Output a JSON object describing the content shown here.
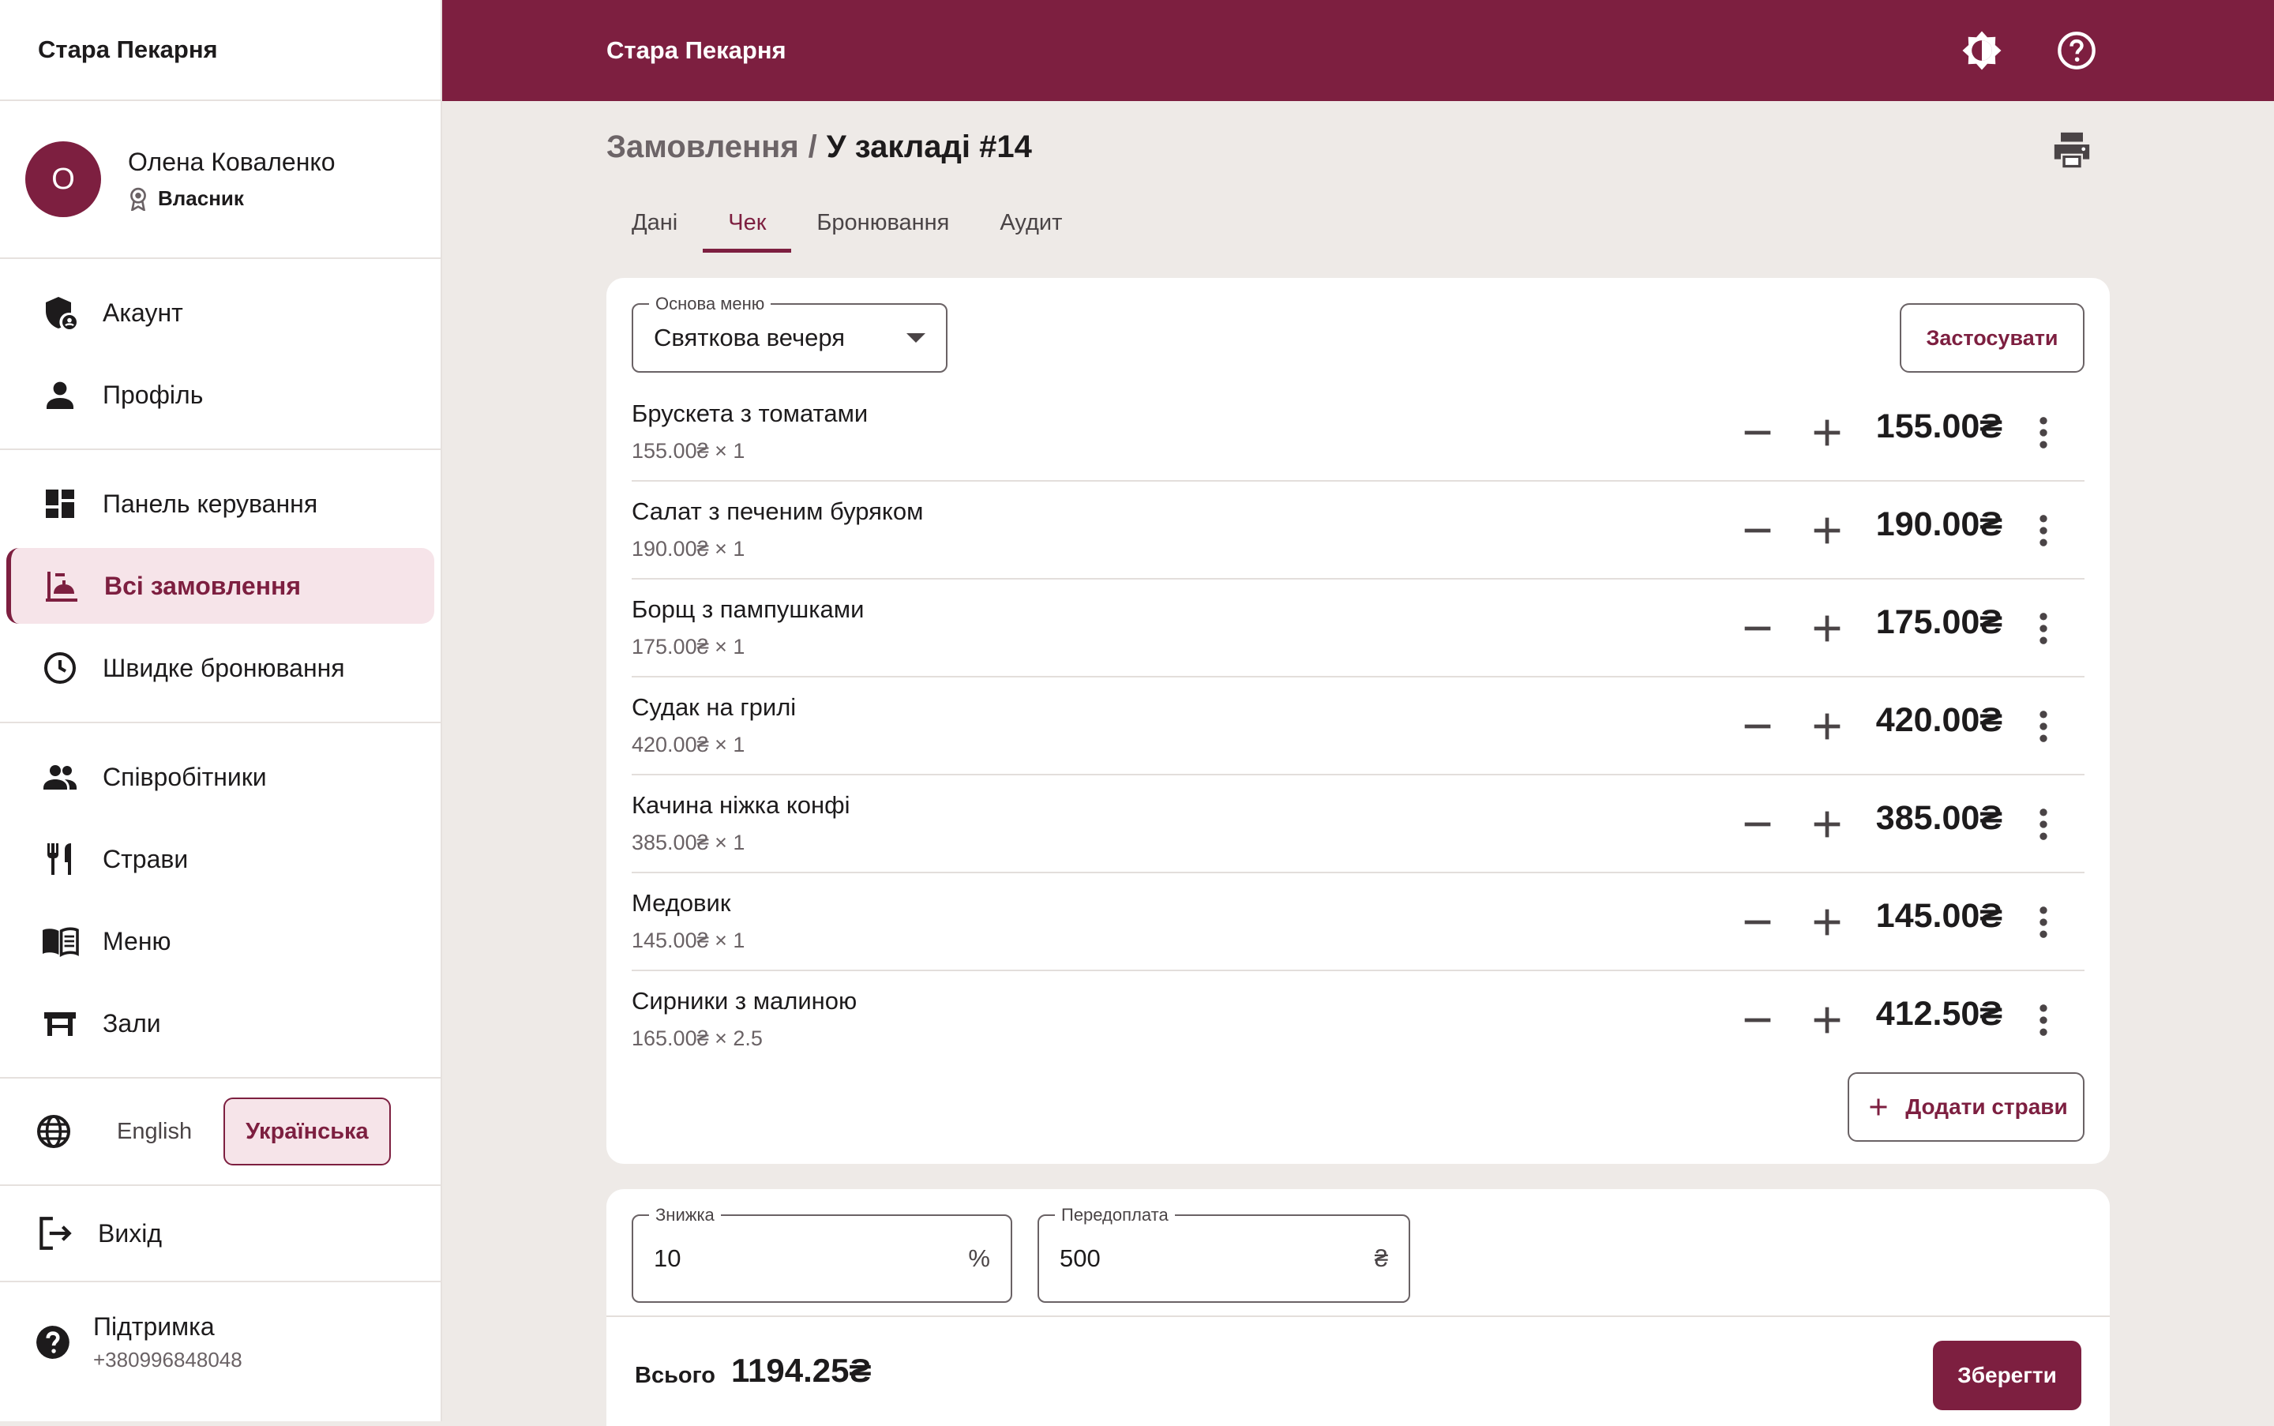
{
  "app": {
    "name": "Стара Пекарня",
    "topbar_title": "Стара Пекарня"
  },
  "user": {
    "initial": "О",
    "name": "Олена Коваленко",
    "role": "Власник"
  },
  "nav": {
    "account": "Акаунт",
    "profile": "Профіль",
    "dashboard": "Панель керування",
    "all_orders": "Всі замовлення",
    "quick_booking": "Швидке бронювання",
    "staff": "Співробітники",
    "dishes": "Страви",
    "menu": "Меню",
    "halls": "Зали",
    "logout": "Вихід"
  },
  "languages": {
    "english": "English",
    "ukrainian": "Українська",
    "active": "Українська"
  },
  "support": {
    "title": "Підтримка",
    "phone": "+380996848048"
  },
  "breadcrumb": {
    "parent": "Замовлення",
    "separator": "/",
    "current": "У закладі #14"
  },
  "tabs": [
    {
      "label": "Дані",
      "active": false
    },
    {
      "label": "Чек",
      "active": true
    },
    {
      "label": "Бронювання",
      "active": false
    },
    {
      "label": "Аудит",
      "active": false
    }
  ],
  "menu_base": {
    "label": "Основа меню",
    "value": "Святкова вечеря",
    "apply_label": "Застосувати"
  },
  "items": [
    {
      "name": "Брускета з томатами",
      "detail": "155.00₴ × 1",
      "total": "155.00₴"
    },
    {
      "name": "Салат з печеним буряком",
      "detail": "190.00₴ × 1",
      "total": "190.00₴"
    },
    {
      "name": "Борщ з пампушками",
      "detail": "175.00₴ × 1",
      "total": "175.00₴"
    },
    {
      "name": "Судак на грилі",
      "detail": "420.00₴ × 1",
      "total": "420.00₴"
    },
    {
      "name": "Качина ніжка конфі",
      "detail": "385.00₴ × 1",
      "total": "385.00₴"
    },
    {
      "name": "Медовик",
      "detail": "145.00₴ × 1",
      "total": "145.00₴"
    },
    {
      "name": "Сирники з малиною",
      "detail": "165.00₴ × 2.5",
      "total": "412.50₴"
    }
  ],
  "add_dishes_label": "Додати страви",
  "discount": {
    "label": "Знижка",
    "value": "10",
    "suffix": "%"
  },
  "prepayment": {
    "label": "Передоплата",
    "value": "500",
    "suffix": "₴"
  },
  "summary": {
    "total_label": "Всього",
    "total_value": "1194.25₴",
    "save_label": "Зберегти"
  },
  "colors": {
    "primary": "#7d1f40",
    "background": "#eeeae7",
    "active_nav_bg": "#f6e4e9"
  },
  "icons": {
    "theme": "brightness-icon",
    "help": "help-icon",
    "print": "printer-icon"
  }
}
